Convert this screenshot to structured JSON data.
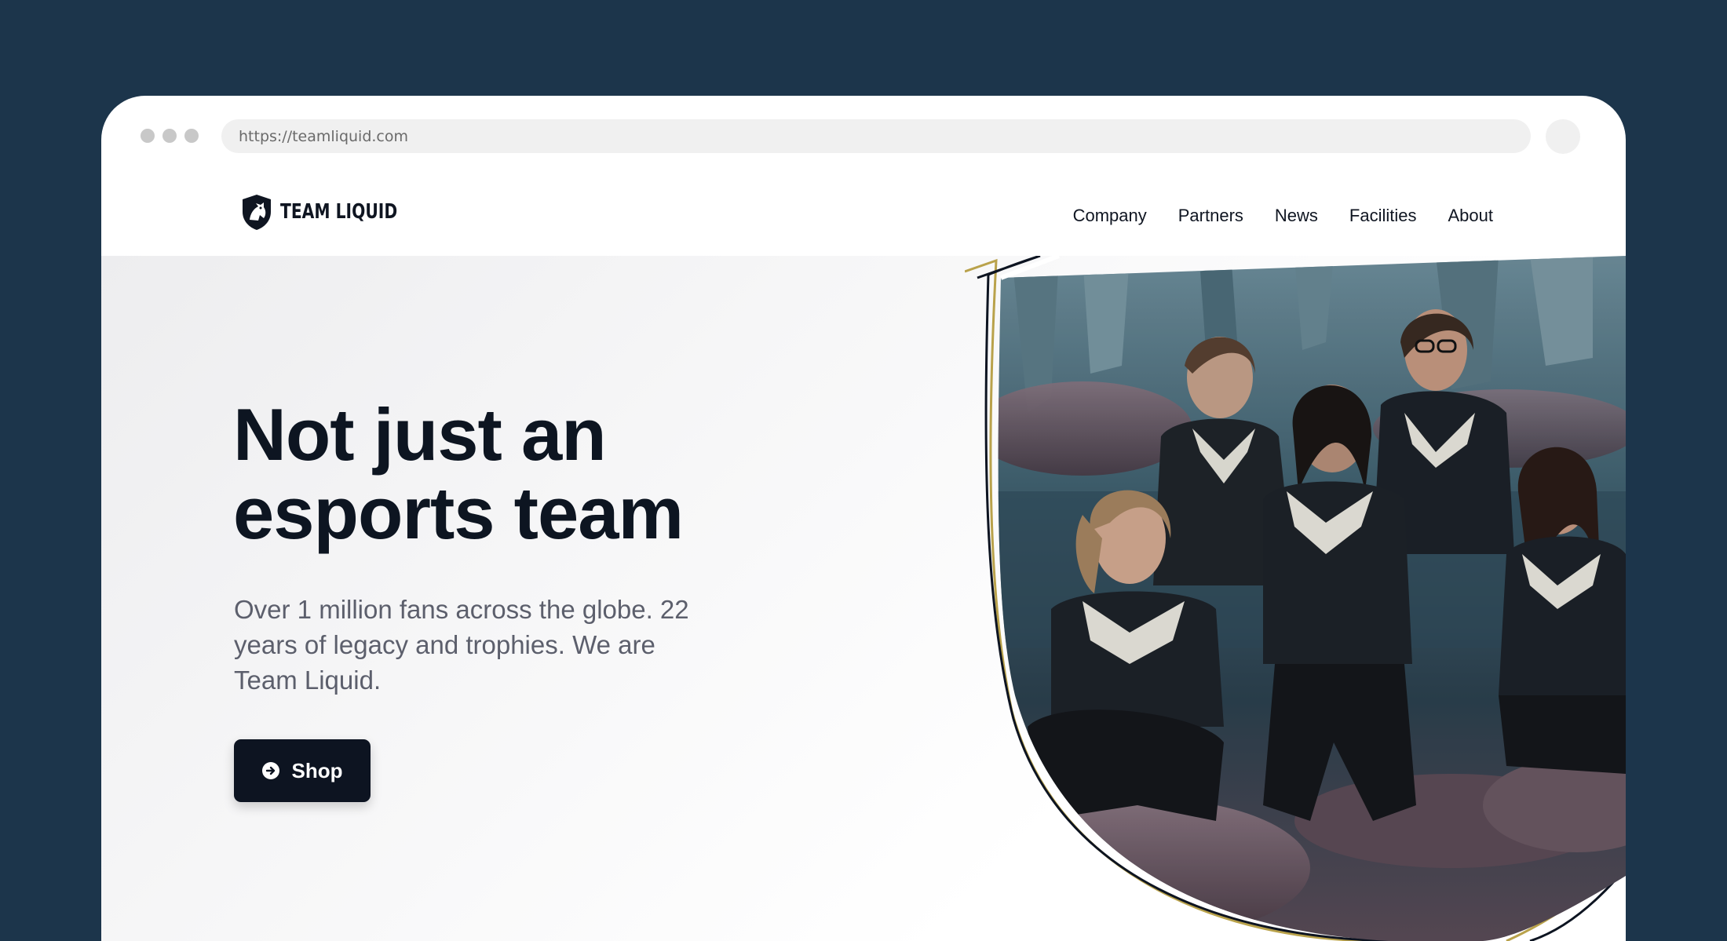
{
  "browser": {
    "url": "https://teamliquid.com"
  },
  "header": {
    "logo_text": "TEAM LIQUID",
    "nav": [
      "Company",
      "Partners",
      "News",
      "Facilities",
      "About"
    ]
  },
  "hero": {
    "headline_line1": "Not just an",
    "headline_line2": "esports team",
    "subtext": "Over 1 million fans across the globe. 22 years of legacy and trophies. We are Team Liquid.",
    "cta_label": "Shop"
  },
  "colors": {
    "backdrop": "#1c354b",
    "accent_gold": "#b9a24b",
    "text_dark": "#0d1521",
    "text_muted": "#5c5f6c"
  },
  "icons": {
    "logo": "horse-shield-icon",
    "cta": "arrow-right-circle-icon"
  }
}
